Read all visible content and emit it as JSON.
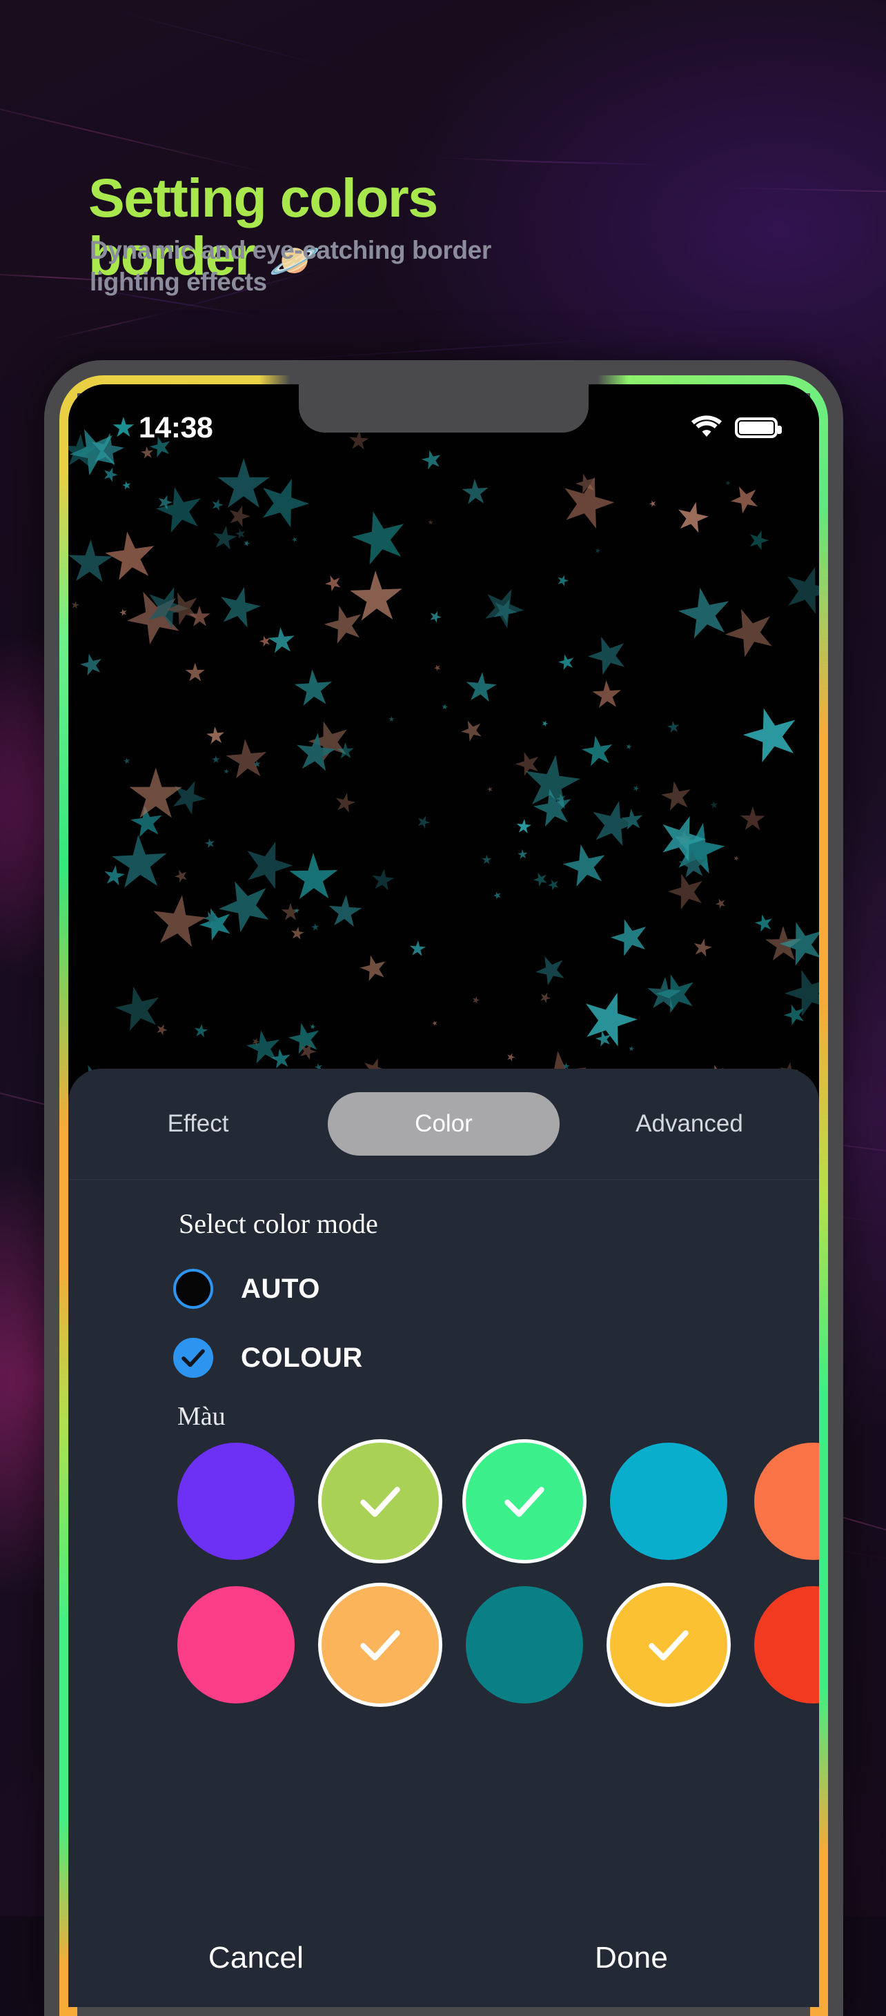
{
  "promo": {
    "headline": "Setting colors\nborder ",
    "headline_emoji": "🪐",
    "subhead": "Dynamic and eye-catching border\nlighting effects",
    "headline_color": "#a9e84d",
    "subhead_color": "#8b8d9c"
  },
  "statusbar": {
    "star_glyph": "★",
    "star_color": "#1d8f92",
    "time": "14:38",
    "wifi_icon": "wifi-icon",
    "battery_icon": "battery-full-icon"
  },
  "sheet": {
    "tabs": [
      {
        "label": "Effect",
        "active": false
      },
      {
        "label": "Color",
        "active": true
      },
      {
        "label": "Advanced",
        "active": false
      }
    ],
    "section_title": "Select color mode",
    "modes": [
      {
        "label": "AUTO",
        "checked": false
      },
      {
        "label": "COLOUR",
        "checked": true
      }
    ],
    "swatch_group_label": "Màu",
    "accent_blue": "#2d95f0",
    "swatch_rows": [
      [
        {
          "color": "#6c31f5",
          "selected": false
        },
        {
          "color": "#a9d155",
          "selected": true
        },
        {
          "color": "#3bf08a",
          "selected": true
        },
        {
          "color": "#0aaecd",
          "selected": false
        },
        {
          "color": "#fb7448",
          "selected": false
        }
      ],
      [
        {
          "color": "#fb3e87",
          "selected": false
        },
        {
          "color": "#fcb45a",
          "selected": true
        },
        {
          "color": "#0a7f86",
          "selected": false
        },
        {
          "color": "#fcc033",
          "selected": true
        },
        {
          "color": "#f23a21",
          "selected": false
        }
      ]
    ],
    "actions": [
      {
        "label": "Cancel"
      },
      {
        "label": "Done"
      }
    ]
  },
  "border_glow": {
    "top_left_color": "#e9d043",
    "top_right_color": "#76ef7c",
    "left_colors": [
      "#34e87c",
      "#f5ab36",
      "#45ef84"
    ],
    "right_colors": [
      "#5fe97c",
      "#f7a93a",
      "#3fee82"
    ]
  }
}
